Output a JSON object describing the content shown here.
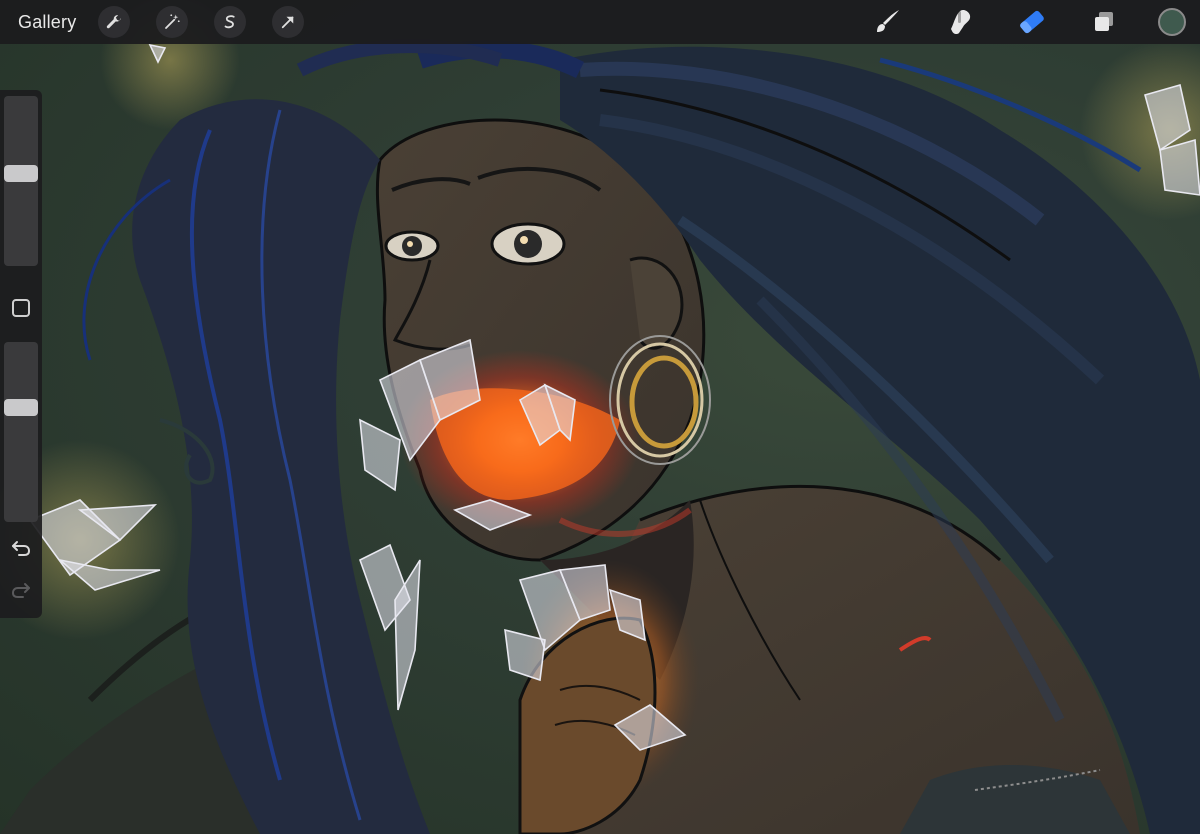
{
  "toolbar": {
    "gallery_label": "Gallery",
    "left_tools": [
      {
        "icon": "wrench-icon",
        "name": "actions"
      },
      {
        "icon": "magic-wand-icon",
        "name": "adjustments"
      },
      {
        "icon": "selection-s-icon",
        "name": "selection"
      },
      {
        "icon": "transform-arrow-icon",
        "name": "transform"
      }
    ],
    "right_tools": [
      {
        "icon": "brush-icon",
        "name": "brush"
      },
      {
        "icon": "smudge-icon",
        "name": "smudge"
      },
      {
        "icon": "eraser-icon",
        "name": "eraser",
        "active": true
      },
      {
        "icon": "layers-icon",
        "name": "layers"
      }
    ],
    "active_color": "#3f5a4e",
    "accent_color": "#2f7cf6"
  },
  "sidebar": {
    "brush_size_level": 0.55,
    "opacity_level": 0.65,
    "modify_button_icon": "square-icon",
    "undo_icon": "undo-icon",
    "redo_icon": "redo-icon"
  },
  "colors": {
    "toolbar_bg": "#1c1c1e",
    "canvas_bg": "#2f3e34",
    "glow": "#ff8a2b"
  }
}
